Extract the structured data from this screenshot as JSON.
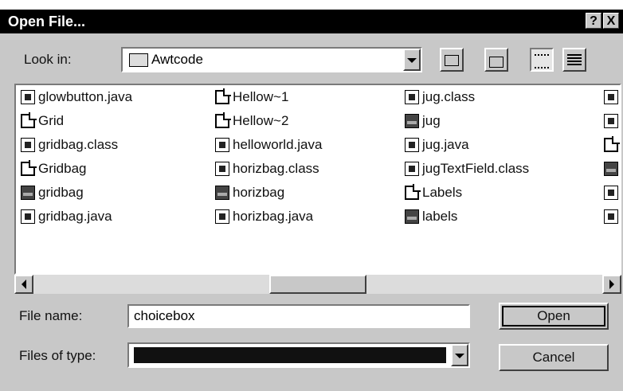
{
  "title": "Open File...",
  "title_buttons": {
    "help": "?",
    "close": "X"
  },
  "look_in": {
    "label": "Look in:",
    "value": "Awtcode"
  },
  "toolbar": {
    "up": "up-folder",
    "new_folder": "new-folder",
    "list": "list-view",
    "details": "details-view"
  },
  "files": [
    {
      "name": "glowbutton.java",
      "type": "java"
    },
    {
      "name": "Grid",
      "type": "doc"
    },
    {
      "name": "gridbag.class",
      "type": "class"
    },
    {
      "name": "Gridbag",
      "type": "doc"
    },
    {
      "name": "gridbag",
      "type": "exe"
    },
    {
      "name": "gridbag.java",
      "type": "java"
    },
    {
      "name": "Hellow~1",
      "type": "doc"
    },
    {
      "name": "Hellow~2",
      "type": "doc"
    },
    {
      "name": "helloworld.java",
      "type": "java"
    },
    {
      "name": "horizbag.class",
      "type": "class"
    },
    {
      "name": "horizbag",
      "type": "exe"
    },
    {
      "name": "horizbag.java",
      "type": "java"
    },
    {
      "name": "jug.class",
      "type": "class"
    },
    {
      "name": "jug",
      "type": "exe"
    },
    {
      "name": "jug.java",
      "type": "java"
    },
    {
      "name": "jugTextField.class",
      "type": "class"
    },
    {
      "name": "Labels",
      "type": "doc"
    },
    {
      "name": "labels",
      "type": "exe"
    }
  ],
  "file_name": {
    "label": "File name:",
    "value": "choicebox"
  },
  "files_of_type": {
    "label": "Files of type:",
    "value": ""
  },
  "buttons": {
    "open": "Open",
    "cancel": "Cancel"
  }
}
